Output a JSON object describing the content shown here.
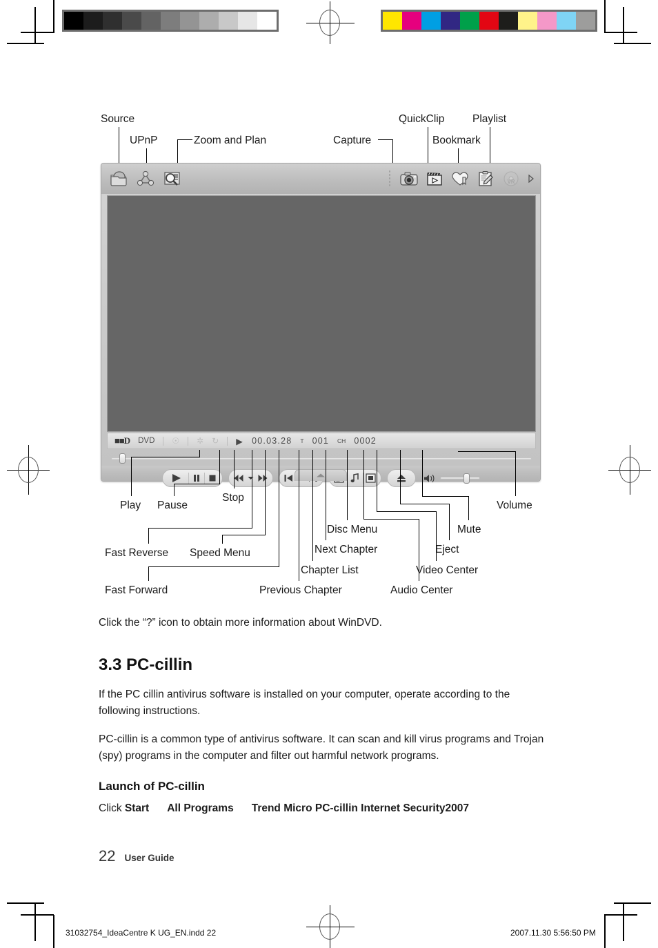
{
  "print_marks": {
    "grayscale_swatches": [
      "#000000",
      "#1c1c1c",
      "#2f2f2f",
      "#4a4a4a",
      "#636363",
      "#7d7d7d",
      "#949494",
      "#adadad",
      "#c8c8c8",
      "#e6e6e6",
      "#ffffff"
    ],
    "color_swatches": [
      "#ffe600",
      "#e6007e",
      "#009fe3",
      "#312783",
      "#00a04a",
      "#e30613",
      "#1d1d1b",
      "#fff38a",
      "#f498c8",
      "#7fd4f5",
      "#9d9d9c"
    ],
    "footer_left": "31032754_IdeaCentre K UG_EN.indd   22",
    "footer_right": "2007.11.30   5:56:50 PM"
  },
  "figure": {
    "callouts_top": [
      {
        "label": "Source"
      },
      {
        "label": "UPnP"
      },
      {
        "label": "Zoom and Plan"
      },
      {
        "label": "Capture"
      },
      {
        "label": "QuickClip"
      },
      {
        "label": "Bookmark"
      },
      {
        "label": "Playlist"
      }
    ],
    "callouts_bottom": [
      {
        "label": "Play"
      },
      {
        "label": "Pause"
      },
      {
        "label": "Stop"
      },
      {
        "label": "Fast Reverse"
      },
      {
        "label": "Speed Menu"
      },
      {
        "label": "Fast Forward"
      },
      {
        "label": "Previous Chapter"
      },
      {
        "label": "Chapter List"
      },
      {
        "label": "Next Chapter"
      },
      {
        "label": "Disc Menu"
      },
      {
        "label": "Audio Center"
      },
      {
        "label": "Video Center"
      },
      {
        "label": "Eject"
      },
      {
        "label": "Mute"
      },
      {
        "label": "Volume"
      }
    ]
  },
  "player": {
    "toolbar": {
      "left_icons": [
        {
          "name": "source-icon",
          "label": "Source"
        },
        {
          "name": "upnp-icon",
          "label": "UPnP"
        },
        {
          "name": "zoom-and-plan-icon",
          "label": "Zoom and Plan"
        }
      ],
      "right_icons": [
        {
          "name": "capture-icon",
          "label": "Capture"
        },
        {
          "name": "quickclip-icon",
          "label": "QuickClip"
        },
        {
          "name": "bookmark-icon",
          "label": "Bookmark"
        },
        {
          "name": "playlist-icon",
          "label": "Playlist"
        },
        {
          "name": "vr-disc-icon",
          "label": "VR"
        },
        {
          "name": "more-arrow-icon",
          "label": "More"
        }
      ]
    },
    "status": {
      "audio_format": "D",
      "disc_type": "DVD",
      "play_state": "play",
      "time": "00.03.28",
      "title_prefix": "T",
      "title": "001",
      "chapter_prefix": "CH",
      "chapter": "0002"
    },
    "seek": {
      "position_percent": 3
    },
    "controls": {
      "play": "Play",
      "pause": "Pause",
      "stop": "Stop",
      "fast_reverse": "Fast Reverse",
      "speed_menu": "Speed Menu",
      "fast_forward": "Fast Forward",
      "previous_chapter": "Previous Chapter",
      "chapter_list": "Chapter List",
      "next_chapter": "Next Chapter",
      "disc_menu": "Disc Menu",
      "audio_center": "Audio Center",
      "video_center": "Video Center",
      "eject": "Eject",
      "mute": "Mute",
      "volume": "Volume",
      "volume_percent": 60
    },
    "colors": {
      "screen": "#666666",
      "chrome_light": "#cfcfcf",
      "chrome_dark": "#b2b2b2"
    }
  },
  "content": {
    "intro": "Click the “?” icon to obtain more information about WinDVD.",
    "section_heading": "3.3 PC-cillin",
    "paragraph_1": "If the PC cillin antivirus software is installed on your computer, operate according to the following instructions.",
    "paragraph_2": "PC-cillin is a common type of antivirus software. It can scan and kill virus programs and Trojan (spy) programs in the computer and filter out harmful network programs.",
    "sub_heading": "Launch of PC-cillin",
    "click_prefix": "Click ",
    "click_step_1": "Start",
    "click_step_2": "All Programs",
    "click_step_3": "Trend Micro PC-cillin Internet Security2007"
  },
  "footer": {
    "page_number": "22",
    "guide_label": "User Guide"
  }
}
